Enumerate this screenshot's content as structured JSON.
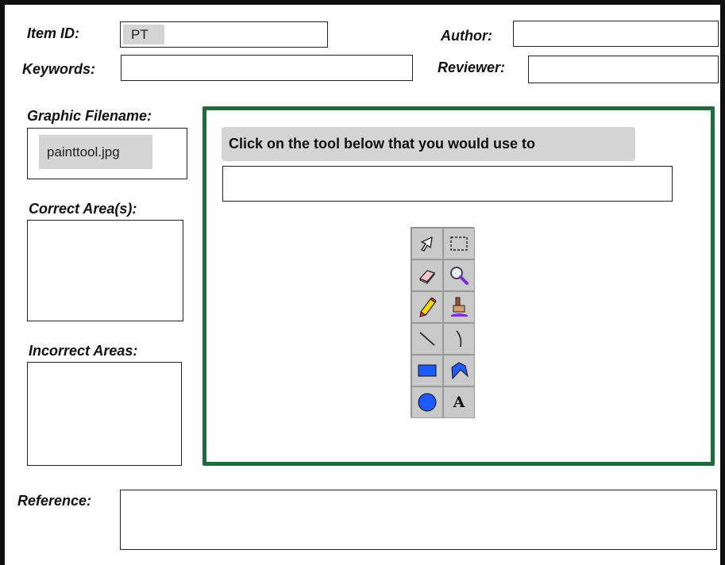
{
  "header": {
    "item_id_label": "Item ID:",
    "item_id_value": "PT",
    "author_label": "Author:",
    "author_value": "",
    "keywords_label": "Keywords:",
    "keywords_value": "",
    "reviewer_label": "Reviewer:",
    "reviewer_value": ""
  },
  "left_panel": {
    "graphic_filename_label": "Graphic Filename:",
    "graphic_filename_value": "painttool.jpg",
    "correct_areas_label": "Correct Area(s):",
    "incorrect_areas_label": "Incorrect Areas:"
  },
  "main": {
    "prompt_text": "Click on the tool below that you would use to",
    "answer_value": "",
    "tools": [
      {
        "name": "select-arrow-icon"
      },
      {
        "name": "select-rectangle-icon"
      },
      {
        "name": "eraser-icon"
      },
      {
        "name": "magnifier-icon"
      },
      {
        "name": "pencil-icon"
      },
      {
        "name": "paint-bucket-icon"
      },
      {
        "name": "line-icon"
      },
      {
        "name": "curve-icon"
      },
      {
        "name": "rectangle-icon"
      },
      {
        "name": "polygon-icon"
      },
      {
        "name": "ellipse-icon"
      },
      {
        "name": "text-icon",
        "glyph": "A"
      }
    ]
  },
  "footer": {
    "reference_label": "Reference:",
    "reference_value": ""
  },
  "colors": {
    "frame": "#111111",
    "panel_border": "#1e6b3b",
    "chip_bg": "#d4d4d4",
    "tool_blue": "#1e5bff",
    "tool_purple": "#8a2be2"
  }
}
